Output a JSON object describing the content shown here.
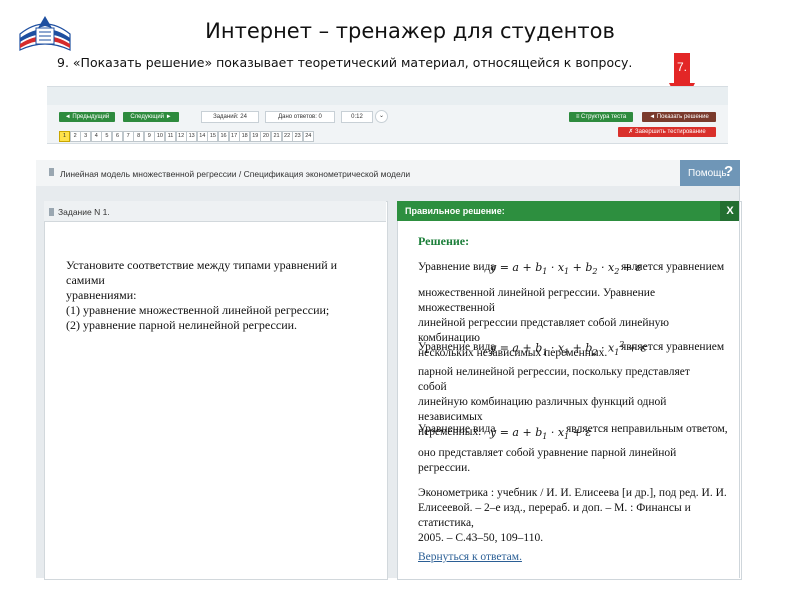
{
  "slide": {
    "title": "Интернет – тренажер для студентов",
    "note": "9.  «Показать  решение» показывает теоретический материал, относящейся к вопросу.",
    "arrow_label": "7."
  },
  "toolbar": {
    "prev_label": "◄ Предыдущий",
    "next_label": "Следующий ►",
    "tasks_label": "Заданий: 24",
    "answers_label": "Дано ответов: 0",
    "time_label": "0:12",
    "structure_label": "≡ Структура теста",
    "show_solution_label": "◄ Показать решение",
    "finish_label": "✗ Завершить тестирование",
    "pages": [
      "1",
      "2",
      "3",
      "4",
      "5",
      "6",
      "7",
      "8",
      "9",
      "10",
      "11",
      "12",
      "13",
      "14",
      "15",
      "16",
      "17",
      "18",
      "19",
      "20",
      "21",
      "22",
      "23",
      "24"
    ],
    "active_page": "1"
  },
  "breadcrumb": "Линейная модель множественной регрессии / Спецификация эконометрической модели",
  "help": {
    "label": "Помощь",
    "icon": "?"
  },
  "task": {
    "title": "Задание N 1.",
    "lines": [
      "Установите соответствие между типами уравнений и самими",
      "уравнениями:",
      "(1) уравнение множественной линейной регрессии;",
      "(2) уравнение парной нелинейной регрессии."
    ]
  },
  "solution": {
    "header": "Правильное решение:",
    "close": "X",
    "heading": "Решение:",
    "p1_prefix": "Уравнение вида",
    "p1_suffix": "является уравнением",
    "p1_lines": [
      "множественной линейной регрессии. Уравнение множественной",
      "линейной регрессии представляет собой линейную комбинацию",
      "нескольких независимых переменных."
    ],
    "p2_prefix": "Уравнение вида",
    "p2_suffix": "является уравнением",
    "p2_lines": [
      "парной нелинейной регрессии, поскольку представляет собой",
      "линейную комбинацию различных функций одной независимых",
      "переменных."
    ],
    "p3_prefix": "Уравнение вида",
    "p3_suffix": "является неправильным ответом,",
    "p3_lines": [
      "оно представляет собой уравнение парной линейной регрессии."
    ],
    "ref_lines": [
      "Эконометрика : учебник / И. И. Елисеева [и др.], под ред. И. И.",
      "Елисеевой. – 2–е изд., перераб. и доп. – М. : Финансы и статистика,",
      "2005. – С.43–50, 109–110."
    ],
    "back_link": "Вернуться к ответам."
  }
}
